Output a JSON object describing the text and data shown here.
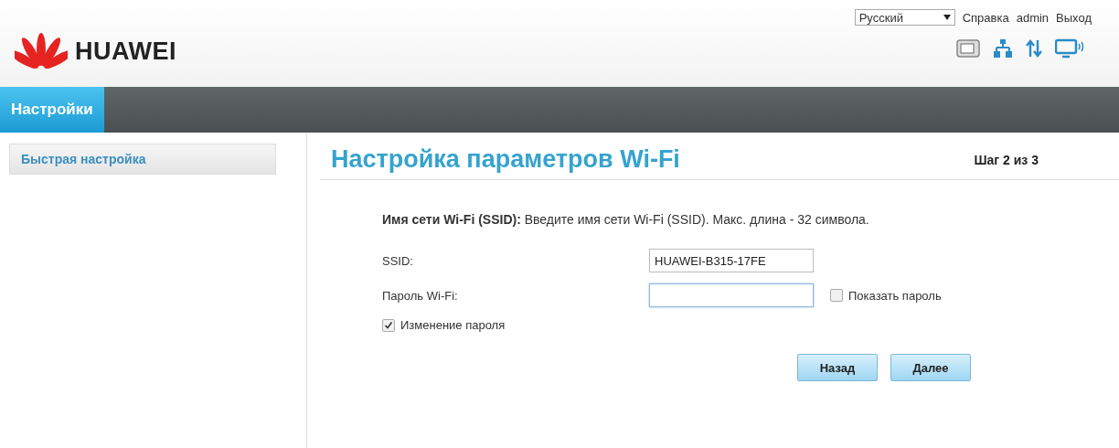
{
  "header": {
    "logo_text": "HUAWEI",
    "language": "Русский",
    "links": [
      "Справка",
      "admin",
      "Выход"
    ]
  },
  "nav": {
    "tabs": [
      {
        "label": "Настройки",
        "selected": true
      }
    ]
  },
  "sidebar": {
    "items": [
      {
        "label": "Быстрая настройка",
        "selected": true
      }
    ]
  },
  "main": {
    "title": "Настройка параметров Wi-Fi",
    "step": "Шаг 2 из 3",
    "description": "**Имя сети Wi-Fi (SSID):** Введите имя сети Wi-Fi (SSID). Макс. длина - 32 символа.",
    "fields": [
      {
        "label": "SSID:",
        "value": "HUAWEI-B315-17FE",
        "focused": false
      },
      {
        "label": "Пароль Wi-Fi:",
        "focused": true,
        "option": {
          "label": "Показать пароль",
          "checked": false
        }
      }
    ],
    "change_password": {
      "label": "Изменение пароля",
      "checked": true
    },
    "buttons": [
      "Назад",
      "Далее"
    ]
  }
}
